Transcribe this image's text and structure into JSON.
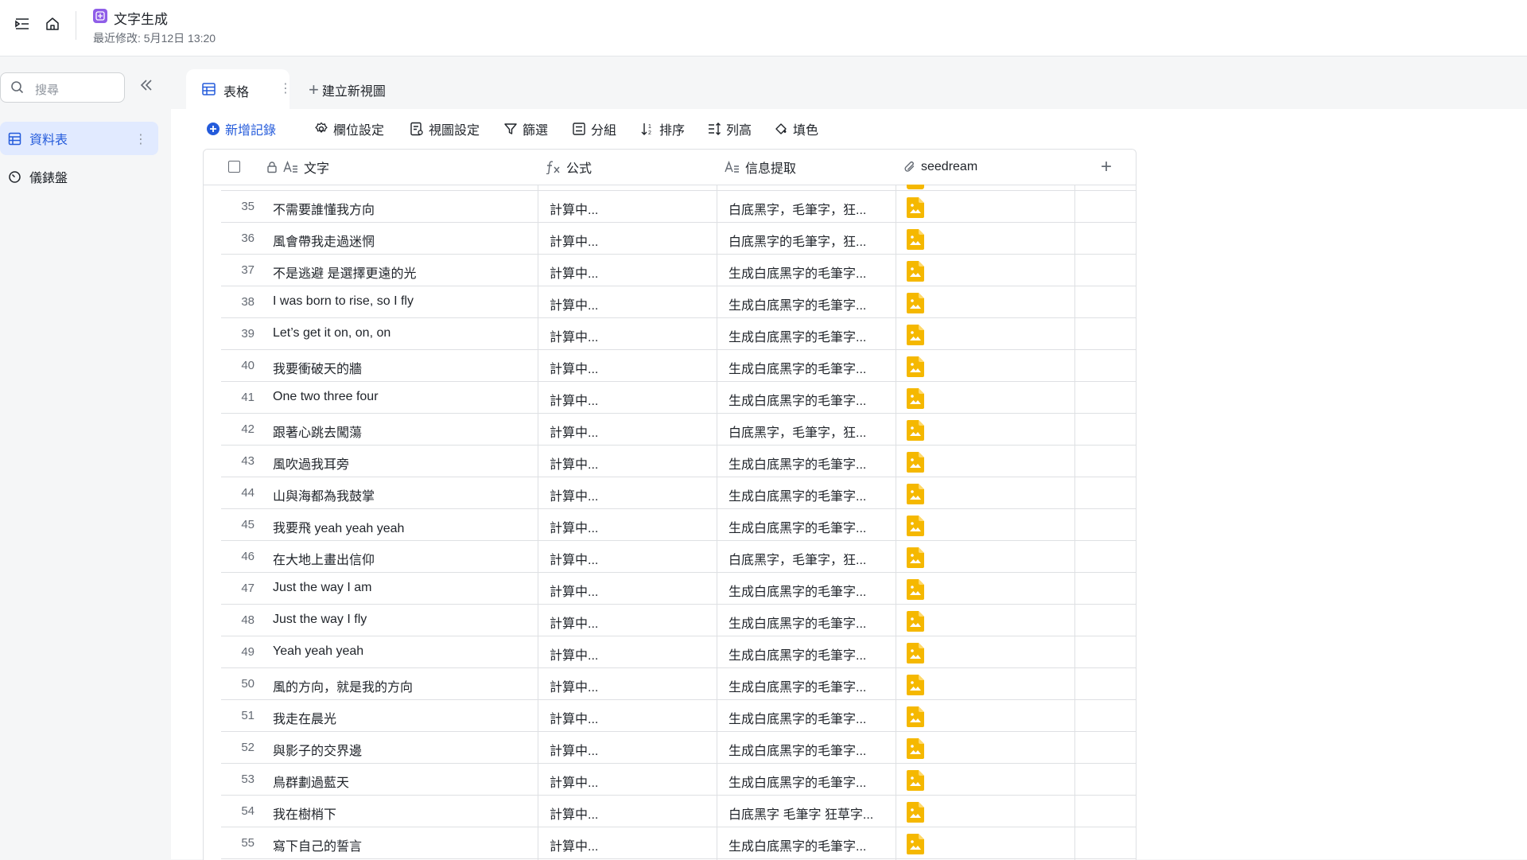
{
  "header": {
    "app_title": "文字生成",
    "last_modified": "最近修改: 5月12日 13:20"
  },
  "sidebar": {
    "search_placeholder": "搜尋",
    "items": [
      {
        "label": "資料表",
        "icon": "table-icon",
        "active": true
      },
      {
        "label": "儀錶盤",
        "icon": "dashboard-icon",
        "active": false
      }
    ]
  },
  "tabs": {
    "active_label": "表格",
    "new_view_label": "建立新視圖"
  },
  "toolbar": {
    "add_record": "新增記錄",
    "field_settings": "欄位設定",
    "view_settings": "視圖設定",
    "filter": "篩選",
    "group": "分組",
    "sort": "排序",
    "row_height": "列高",
    "fill_color": "填色"
  },
  "table": {
    "columns": [
      "文字",
      "公式",
      "信息提取",
      "seedream"
    ],
    "rows": [
      {
        "n": "35",
        "text": "不需要誰懂我方向",
        "formula": "計算中...",
        "info": "白底黑字，毛筆字，狂..."
      },
      {
        "n": "36",
        "text": "風會帶我走過迷惘",
        "formula": "計算中...",
        "info": "白底黑字的毛筆字，狂..."
      },
      {
        "n": "37",
        "text": "不是逃避 是選擇更遠的光",
        "formula": "計算中...",
        "info": "生成白底黑字的毛筆字..."
      },
      {
        "n": "38",
        "text": "I was born to rise, so I fly",
        "formula": "計算中...",
        "info": "生成白底黑字的毛筆字..."
      },
      {
        "n": "39",
        "text": "Let’s get it on, on, on",
        "formula": "計算中...",
        "info": "生成白底黑字的毛筆字..."
      },
      {
        "n": "40",
        "text": "我要衝破天的牆",
        "formula": "計算中...",
        "info": "生成白底黑字的毛筆字..."
      },
      {
        "n": "41",
        "text": "One two three four",
        "formula": "計算中...",
        "info": "生成白底黑字的毛筆字..."
      },
      {
        "n": "42",
        "text": "跟著心跳去闖蕩",
        "formula": "計算中...",
        "info": "白底黑字，毛筆字，狂..."
      },
      {
        "n": "43",
        "text": "風吹過我耳旁",
        "formula": "計算中...",
        "info": "生成白底黑字的毛筆字..."
      },
      {
        "n": "44",
        "text": "山與海都為我鼓掌",
        "formula": "計算中...",
        "info": "生成白底黑字的毛筆字..."
      },
      {
        "n": "45",
        "text": "我要飛 yeah yeah yeah",
        "formula": "計算中...",
        "info": "生成白底黑字的毛筆字..."
      },
      {
        "n": "46",
        "text": "在大地上畫出信仰",
        "formula": "計算中...",
        "info": "白底黑字，毛筆字，狂..."
      },
      {
        "n": "47",
        "text": "Just the way I am",
        "formula": "計算中...",
        "info": "生成白底黑字的毛筆字..."
      },
      {
        "n": "48",
        "text": "Just the way I fly",
        "formula": "計算中...",
        "info": "生成白底黑字的毛筆字..."
      },
      {
        "n": "49",
        "text": "Yeah yeah yeah",
        "formula": "計算中...",
        "info": "生成白底黑字的毛筆字..."
      },
      {
        "n": "50",
        "text": "風的方向，就是我的方向",
        "formula": "計算中...",
        "info": "生成白底黑字的毛筆字..."
      },
      {
        "n": "51",
        "text": "我走在晨光",
        "formula": "計算中...",
        "info": "生成白底黑字的毛筆字..."
      },
      {
        "n": "52",
        "text": "與影子的交界邊",
        "formula": "計算中...",
        "info": "生成白底黑字的毛筆字..."
      },
      {
        "n": "53",
        "text": "鳥群劃過藍天",
        "formula": "計算中...",
        "info": "生成白底黑字的毛筆字..."
      },
      {
        "n": "54",
        "text": "我在樹梢下",
        "formula": "計算中...",
        "info": "白底黑字 毛筆字 狂草字..."
      },
      {
        "n": "55",
        "text": "寫下自己的誓言",
        "formula": "計算中...",
        "info": "生成白底黑字的毛筆字..."
      }
    ]
  },
  "colors": {
    "accent": "#245bdb",
    "app_badge": "#8f5ee8",
    "image_file": "#f5b800"
  }
}
